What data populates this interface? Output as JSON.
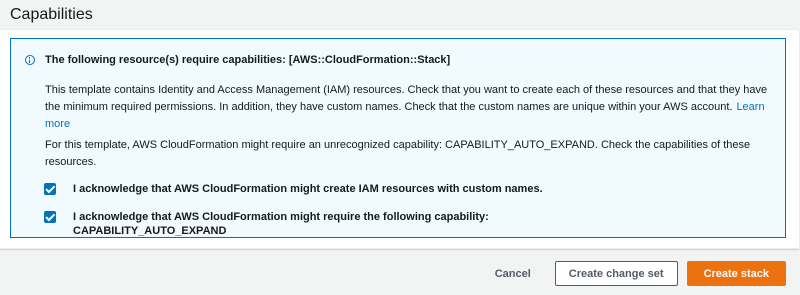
{
  "section": {
    "title": "Capabilities"
  },
  "alert": {
    "title": "The following resource(s) require capabilities: [AWS::CloudFormation::Stack]",
    "paragraph1": "This template contains Identity and Access Management (IAM) resources. Check that you want to create each of these resources and that they have the minimum required permissions. In addition, they have custom names. Check that the custom names are unique within your AWS account.",
    "learn_more": "Learn more",
    "paragraph2": "For this template, AWS CloudFormation might require an unrecognized capability: CAPABILITY_AUTO_EXPAND. Check the capabilities of these resources.",
    "checkboxes": [
      {
        "label": "I acknowledge that AWS CloudFormation might create IAM resources with custom names.",
        "checked": true
      },
      {
        "label": "I acknowledge that AWS CloudFormation might require the following capability:",
        "label_line2": "CAPABILITY_AUTO_EXPAND",
        "checked": true
      }
    ]
  },
  "footer": {
    "cancel": "Cancel",
    "create_change_set": "Create change set",
    "create_stack": "Create stack"
  },
  "colors": {
    "accent": "#0073bb",
    "primary_button": "#ec7211",
    "alert_background": "#f1faff"
  },
  "icons": {
    "alert": "info-icon",
    "checkbox": "check-icon"
  }
}
